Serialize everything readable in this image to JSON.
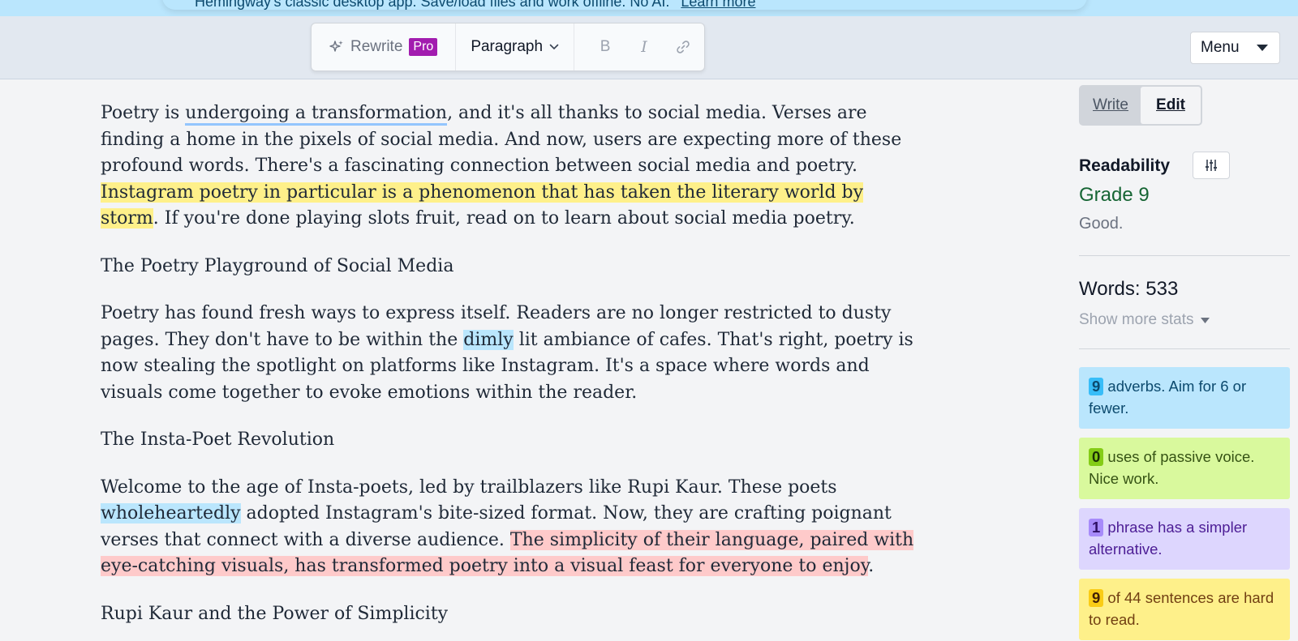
{
  "banner": {
    "text": "Hemingway's classic desktop app. Save/load files and work offline. No AI.",
    "link": "Learn more"
  },
  "toolbar": {
    "rewrite_label": "Rewrite",
    "pro_badge": "Pro",
    "paragraph_label": "Paragraph",
    "bold_label": "B",
    "italic_label": "I"
  },
  "menu": {
    "label": "Menu"
  },
  "editor": {
    "p1": {
      "t1": "Poetry is ",
      "u1": "undergoing a transformation",
      "t2": ", and it's all thanks to social media. Verses are finding a home in the pixels of social media. And now, users are expecting more of these profound words. There's a fascinating connection between social media and poetry. ",
      "y1": "Instagram poetry in particular is a phenomenon that has taken the literary world by storm",
      "t3": ". If you're done playing slots fruit, read on to learn about social media poetry."
    },
    "h1": "The Poetry Playground of Social Media",
    "p2": {
      "t1": "Poetry has found fresh ways to express itself. Readers are no longer restricted to dusty pages. They don't have to be within the ",
      "b1": "dimly",
      "t2": " lit ambiance of cafes. That's right, poetry is now stealing the spotlight on platforms like Instagram. It's a space where words and visuals come together to evoke emotions within the reader."
    },
    "h2": "The Insta-Poet Revolution",
    "p3": {
      "t1": "Welcome to the age of Insta-poets, led by trailblazers like Rupi Kaur. These poets ",
      "b1": "wholeheartedly",
      "t2": " adopted Instagram's bite-sized format. Now, they are crafting poignant verses that connect with a diverse audience. ",
      "r1": "The simplicity of their language, paired with eye-catching visuals, has transformed poetry into a visual feast for everyone to enjoy",
      "t3": "."
    },
    "h3": "Rupi Kaur and the Power of Simplicity"
  },
  "sidebar": {
    "write_label": "Write",
    "edit_label": "Edit",
    "readability_title": "Readability",
    "grade": "Grade 9",
    "grade_desc": "Good.",
    "words": "Words: 533",
    "more_stats": "Show more stats",
    "cards": [
      {
        "num": "9",
        "text": " adverbs. Aim for 6 or fewer."
      },
      {
        "num": "0",
        "text": " uses of passive voice. Nice work."
      },
      {
        "num": "1",
        "text": " phrase has a simpler alternative."
      },
      {
        "num": "9",
        "text": " of 44 sentences are hard to read."
      }
    ]
  },
  "colors": {
    "adverb_highlight": "#bae6fd",
    "passive_highlight": "#d9f99d",
    "simpler_highlight": "#ddd6fe",
    "hard_highlight": "#fef08a",
    "very_hard_highlight": "#fecaca",
    "pro_badge": "#a21caf",
    "grade_good": "#166534"
  },
  "icons": {
    "rewrite": "sparkle-icon",
    "paragraph_dropdown": "chevron-down-icon",
    "link": "link-icon",
    "menu_dropdown": "caret-down-icon",
    "settings": "sliders-icon",
    "more_stats": "caret-down-icon"
  }
}
